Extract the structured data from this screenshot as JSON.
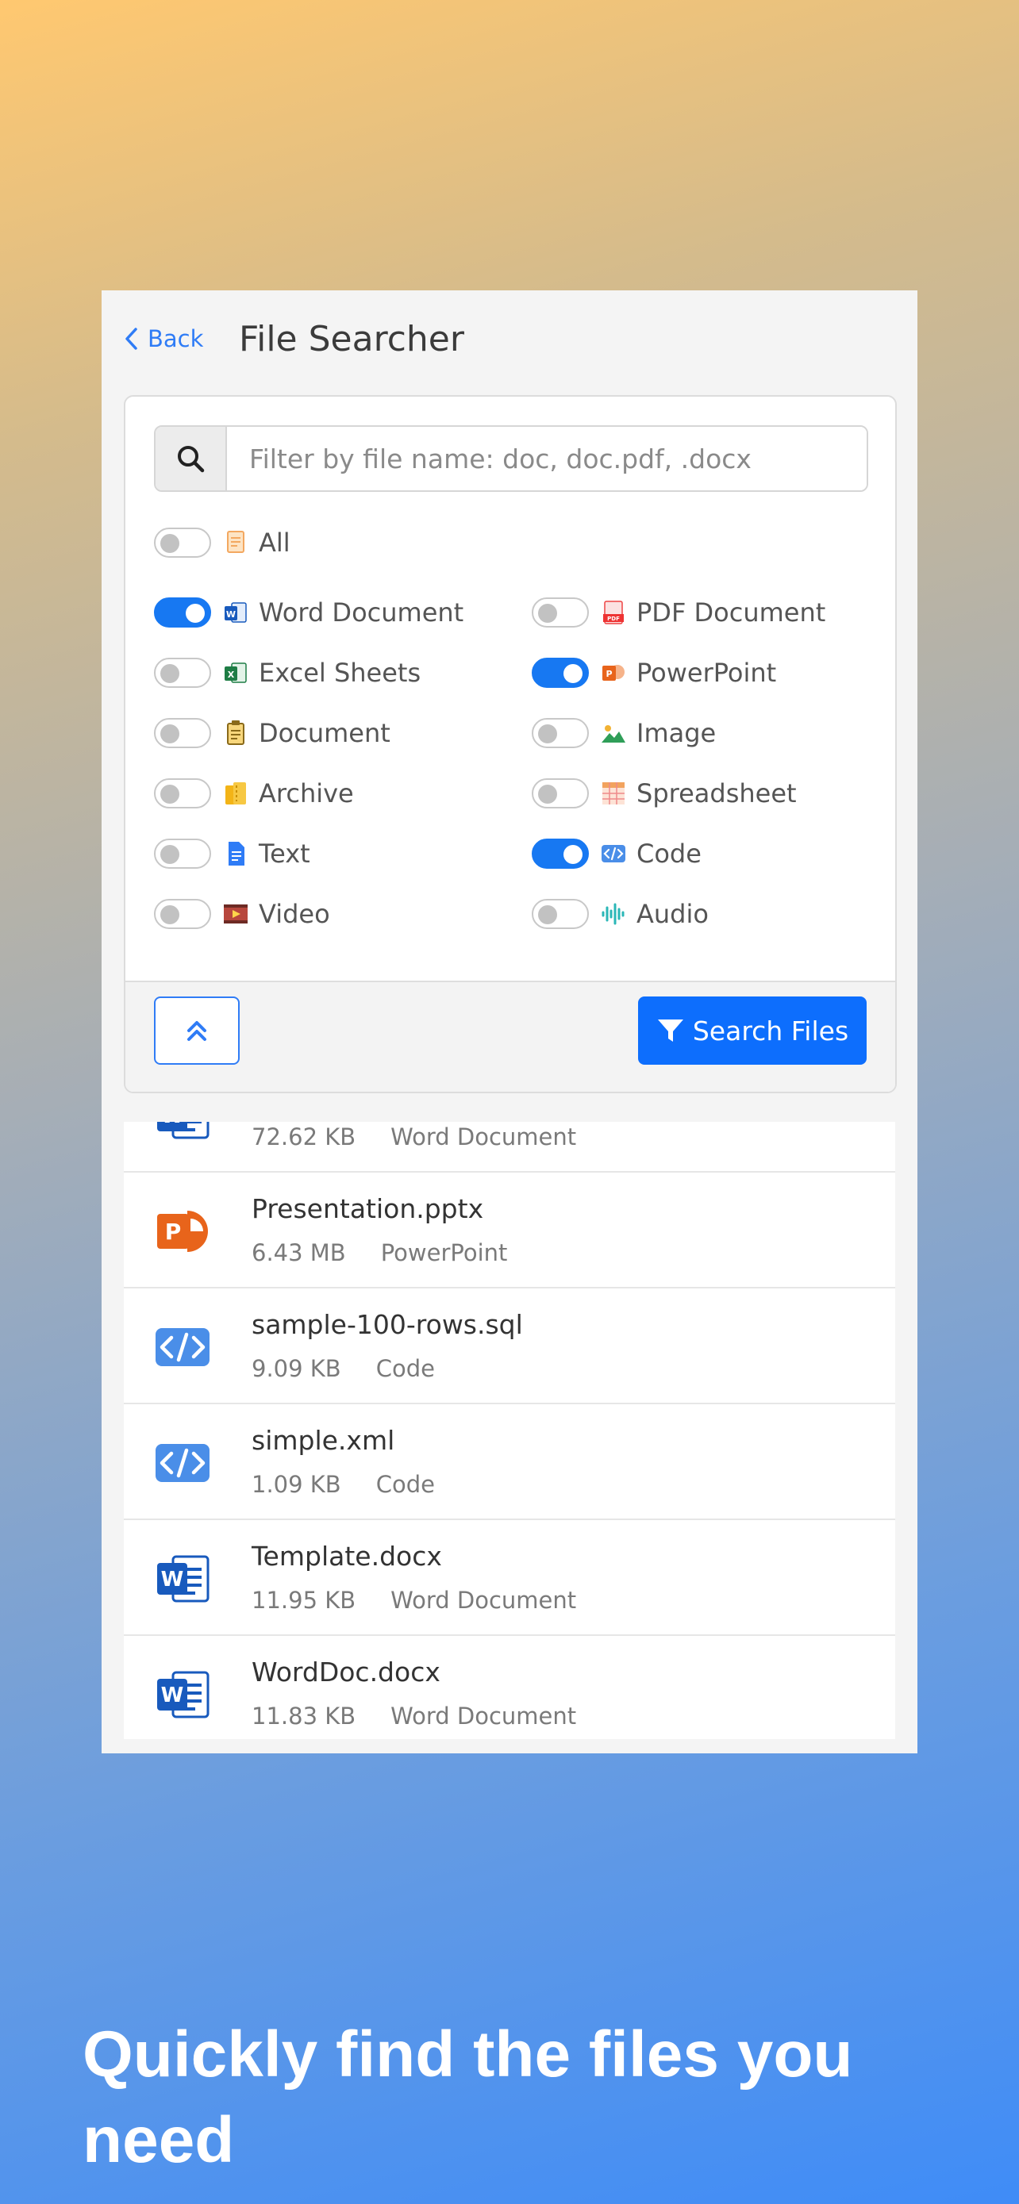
{
  "header": {
    "back_label": "Back",
    "title": "File Searcher"
  },
  "search": {
    "placeholder": "Filter by file name: doc, doc.pdf, .docx",
    "value": ""
  },
  "filters": {
    "all": {
      "label": "All",
      "on": false,
      "icon": "all-files-icon"
    },
    "items": [
      {
        "label": "Word Document",
        "on": true,
        "icon": "word-icon"
      },
      {
        "label": "PDF Document",
        "on": false,
        "icon": "pdf-icon"
      },
      {
        "label": "Excel Sheets",
        "on": false,
        "icon": "excel-icon"
      },
      {
        "label": "PowerPoint",
        "on": true,
        "icon": "powerpoint-icon"
      },
      {
        "label": "Document",
        "on": false,
        "icon": "document-icon"
      },
      {
        "label": "Image",
        "on": false,
        "icon": "image-icon"
      },
      {
        "label": "Archive",
        "on": false,
        "icon": "archive-icon"
      },
      {
        "label": "Spreadsheet",
        "on": false,
        "icon": "spreadsheet-icon"
      },
      {
        "label": "Text",
        "on": false,
        "icon": "text-icon"
      },
      {
        "label": "Code",
        "on": true,
        "icon": "code-icon"
      },
      {
        "label": "Video",
        "on": false,
        "icon": "video-icon"
      },
      {
        "label": "Audio",
        "on": false,
        "icon": "audio-icon"
      }
    ]
  },
  "footer": {
    "search_label": "Search Files"
  },
  "results": [
    {
      "name": "",
      "size": "72.62 KB",
      "type": "Word Document",
      "icon": "word-file-icon"
    },
    {
      "name": "Presentation.pptx",
      "size": "6.43 MB",
      "type": "PowerPoint",
      "icon": "powerpoint-file-icon"
    },
    {
      "name": "sample-100-rows.sql",
      "size": "9.09 KB",
      "type": "Code",
      "icon": "code-file-icon"
    },
    {
      "name": "simple.xml",
      "size": "1.09 KB",
      "type": "Code",
      "icon": "code-file-icon"
    },
    {
      "name": "Template.docx",
      "size": "11.95 KB",
      "type": "Word Document",
      "icon": "word-file-icon"
    },
    {
      "name": "WordDoc.docx",
      "size": "11.83 KB",
      "type": "Word Document",
      "icon": "word-file-icon"
    }
  ],
  "headline": "Quickly find the files you need",
  "colors": {
    "accent": "#0d6efd",
    "toggle_on": "#1778f2",
    "word": "#185abd",
    "powerpoint": "#e8641b",
    "code": "#4a8ee8"
  }
}
